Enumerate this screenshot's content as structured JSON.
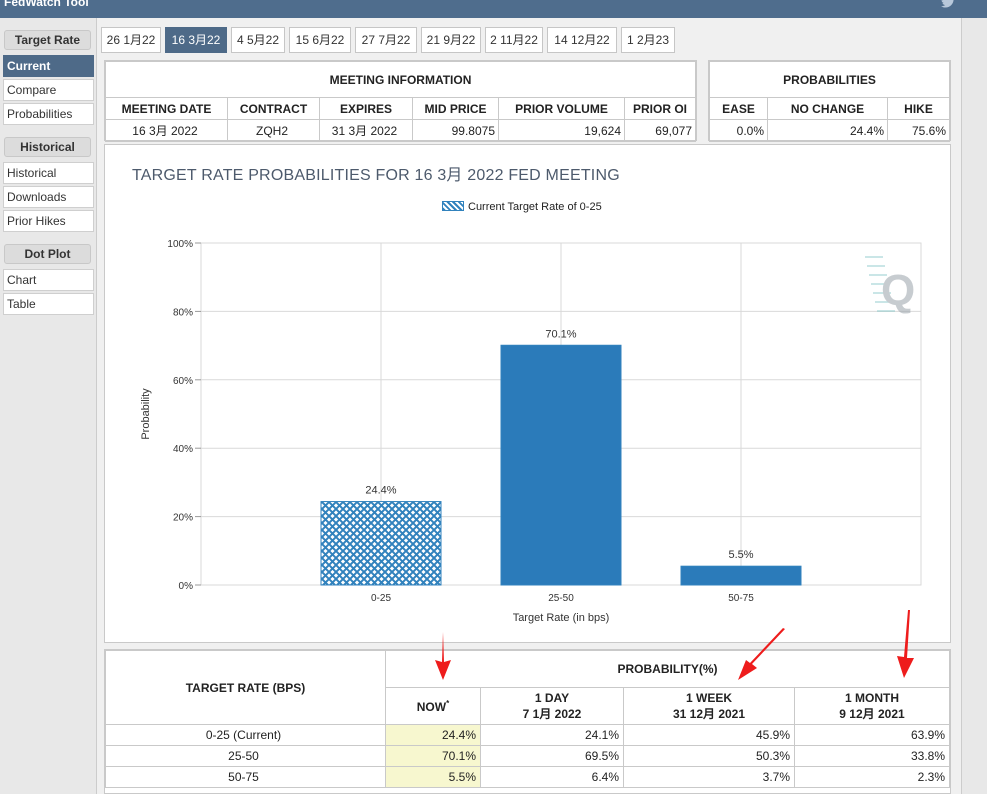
{
  "app": {
    "title": "FedWatch Tool"
  },
  "sidebar": {
    "sections": [
      {
        "heading": "Target Rate",
        "items": [
          {
            "label": "Current",
            "active": true
          },
          {
            "label": "Compare"
          },
          {
            "label": "Probabilities"
          }
        ]
      },
      {
        "heading": "Historical",
        "items": [
          {
            "label": "Historical"
          },
          {
            "label": "Downloads"
          },
          {
            "label": "Prior Hikes"
          }
        ]
      },
      {
        "heading": "Dot Plot",
        "items": [
          {
            "label": "Chart"
          },
          {
            "label": "Table"
          }
        ]
      }
    ]
  },
  "tabs": [
    {
      "label": "26 1月22"
    },
    {
      "label": "16 3月22",
      "active": true
    },
    {
      "label": "4 5月22"
    },
    {
      "label": "15 6月22"
    },
    {
      "label": "27 7月22"
    },
    {
      "label": "21 9月22"
    },
    {
      "label": "2 11月22"
    },
    {
      "label": "14 12月22"
    },
    {
      "label": "1 2月23"
    }
  ],
  "meeting_info": {
    "heading": "MEETING INFORMATION",
    "columns": [
      "MEETING DATE",
      "CONTRACT",
      "EXPIRES",
      "MID PRICE",
      "PRIOR VOLUME",
      "PRIOR OI"
    ],
    "row": [
      "16 3月 2022",
      "ZQH2",
      "31 3月 2022",
      "99.8075",
      "19,624",
      "69,077"
    ]
  },
  "probabilities": {
    "heading": "PROBABILITIES",
    "columns": [
      "EASE",
      "NO CHANGE",
      "HIKE"
    ],
    "row": [
      "0.0%",
      "24.4%",
      "75.6%"
    ]
  },
  "chart": {
    "title": "TARGET RATE PROBABILITIES FOR 16 3月 2022 FED MEETING",
    "legend": "Current Target Rate of 0-25",
    "logo": "Q",
    "colors": {
      "bar": "#2b7bba",
      "hatch": "#3182bd",
      "grid": "#d9d9d9",
      "text": "#4d5a6c"
    }
  },
  "chart_data": {
    "type": "bar",
    "categories": [
      "0-25",
      "25-50",
      "50-75"
    ],
    "values": [
      24.4,
      70.1,
      5.5
    ],
    "data_labels": [
      "24.4%",
      "70.1%",
      "5.5%"
    ],
    "highlighted_category": "0-25",
    "xlabel": "Target Rate (in bps)",
    "ylabel": "Probability",
    "ylim": [
      0,
      100
    ],
    "y_ticks": [
      "0%",
      "20%",
      "40%",
      "60%",
      "80%",
      "100%"
    ],
    "grid": true,
    "legend_position": "top-center"
  },
  "prob_table": {
    "row_header": "TARGET RATE (BPS)",
    "group_header": "PROBABILITY(%)",
    "now": {
      "label": "NOW",
      "sup": "*"
    },
    "cols": [
      {
        "line1": "1 DAY",
        "line2": "7 1月 2022"
      },
      {
        "line1": "1 WEEK",
        "line2": "31 12月 2021"
      },
      {
        "line1": "1 MONTH",
        "line2": "9 12月 2021"
      }
    ],
    "rows": [
      {
        "rate": "0-25 (Current)",
        "values": [
          "24.4%",
          "24.1%",
          "45.9%",
          "63.9%"
        ]
      },
      {
        "rate": "25-50",
        "values": [
          "70.1%",
          "69.5%",
          "50.3%",
          "33.8%"
        ]
      },
      {
        "rate": "50-75",
        "values": [
          "5.5%",
          "6.4%",
          "3.7%",
          "2.3%"
        ]
      }
    ]
  },
  "annotation_color": "#ee1c1c"
}
